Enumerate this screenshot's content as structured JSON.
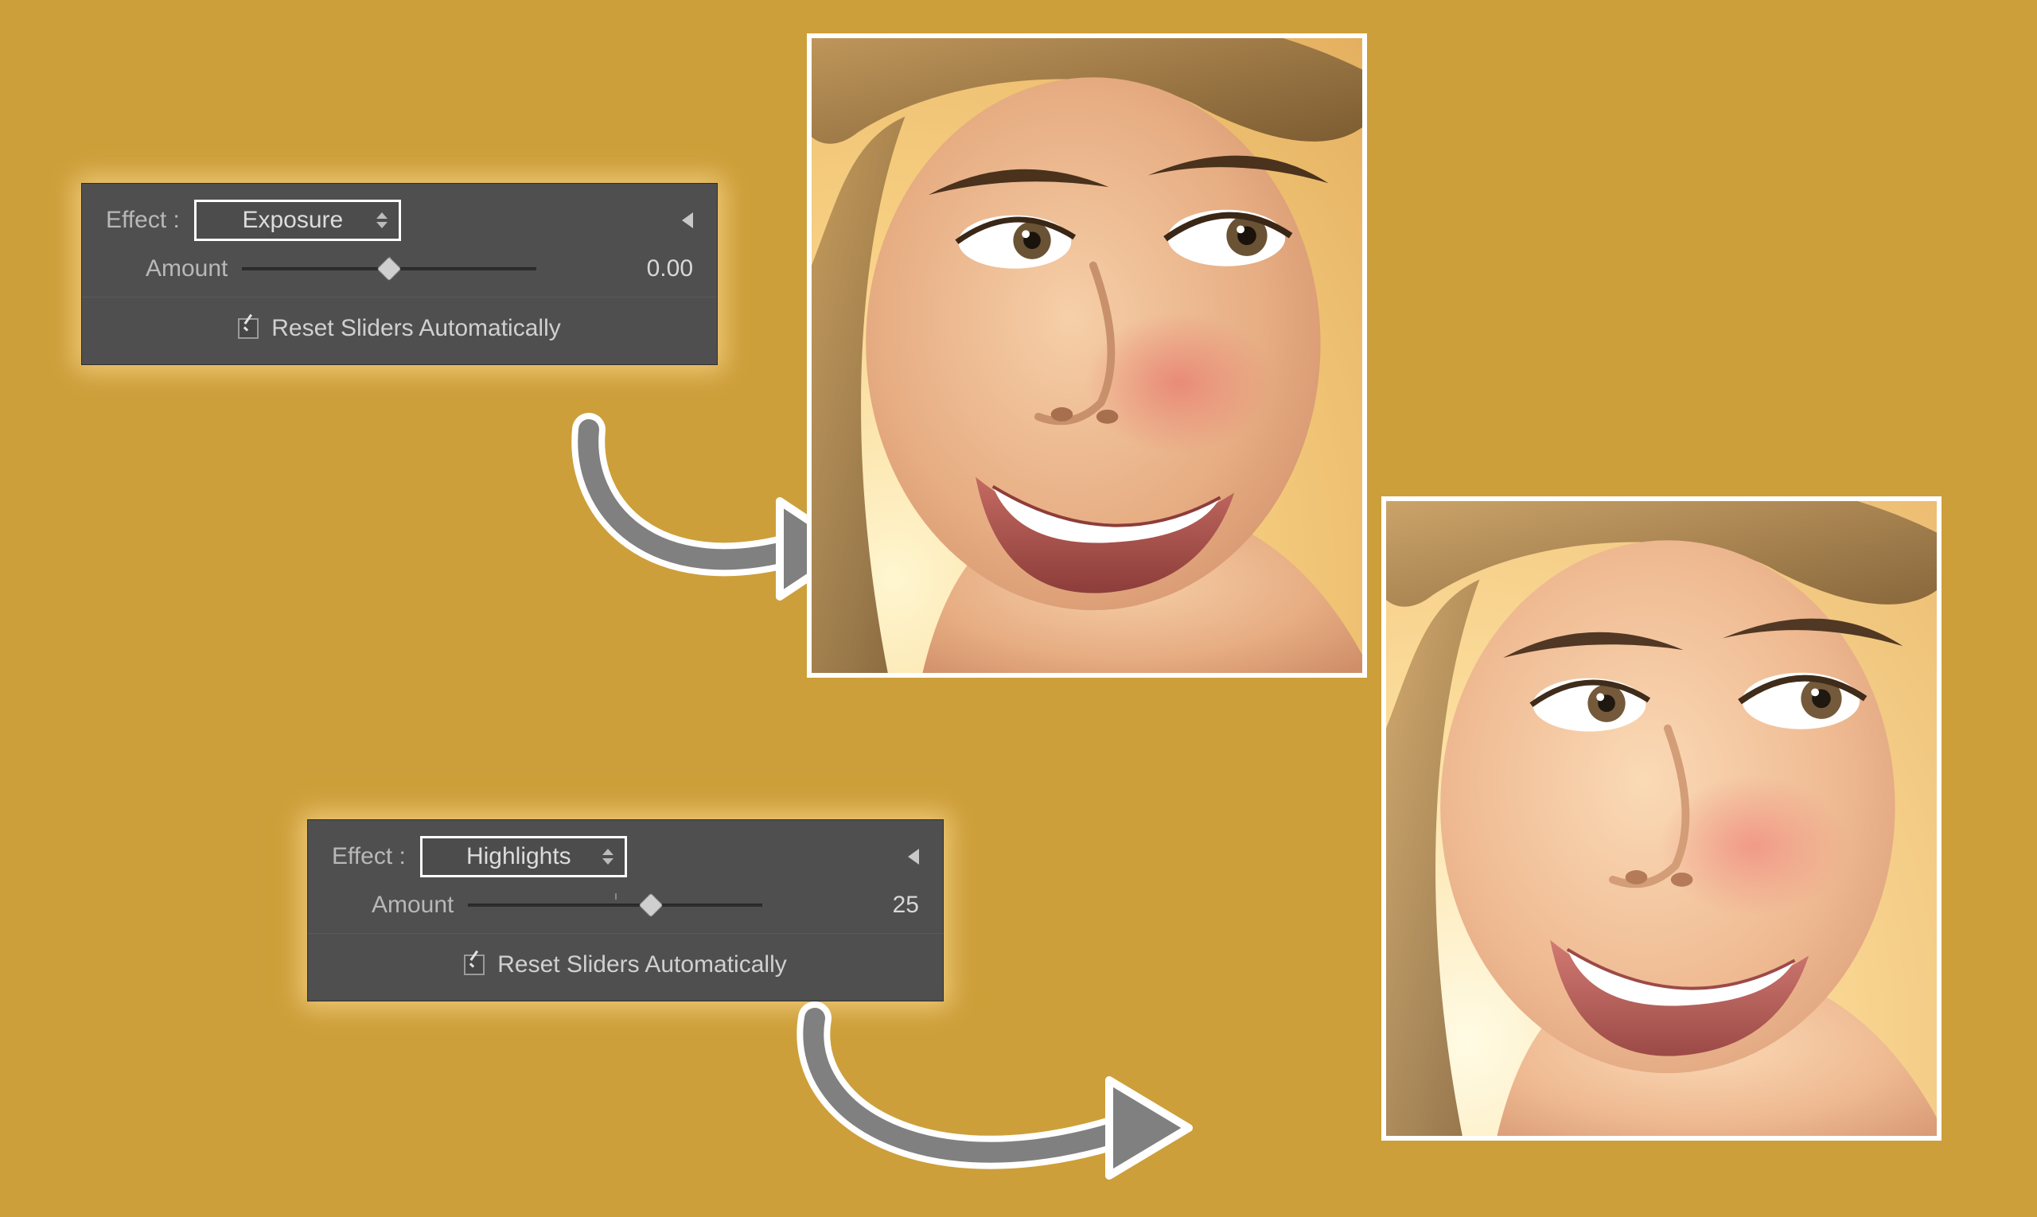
{
  "panels": {
    "top": {
      "effect_label": "Effect :",
      "effect_value": "Exposure",
      "amount_label": "Amount",
      "amount_value": "0.00",
      "slider_percent": 50,
      "reset_label": "Reset Sliders Automatically",
      "reset_checked": true
    },
    "bottom": {
      "effect_label": "Effect :",
      "effect_value": "Highlights",
      "amount_label": "Amount",
      "amount_value": "25",
      "slider_percent": 62,
      "reset_label": "Reset Sliders Automatically",
      "reset_checked": true
    }
  },
  "colors": {
    "page_bg": "#cd9f3a",
    "panel_bg": "#4f4f4f",
    "panel_text": "#c8c8c8"
  }
}
